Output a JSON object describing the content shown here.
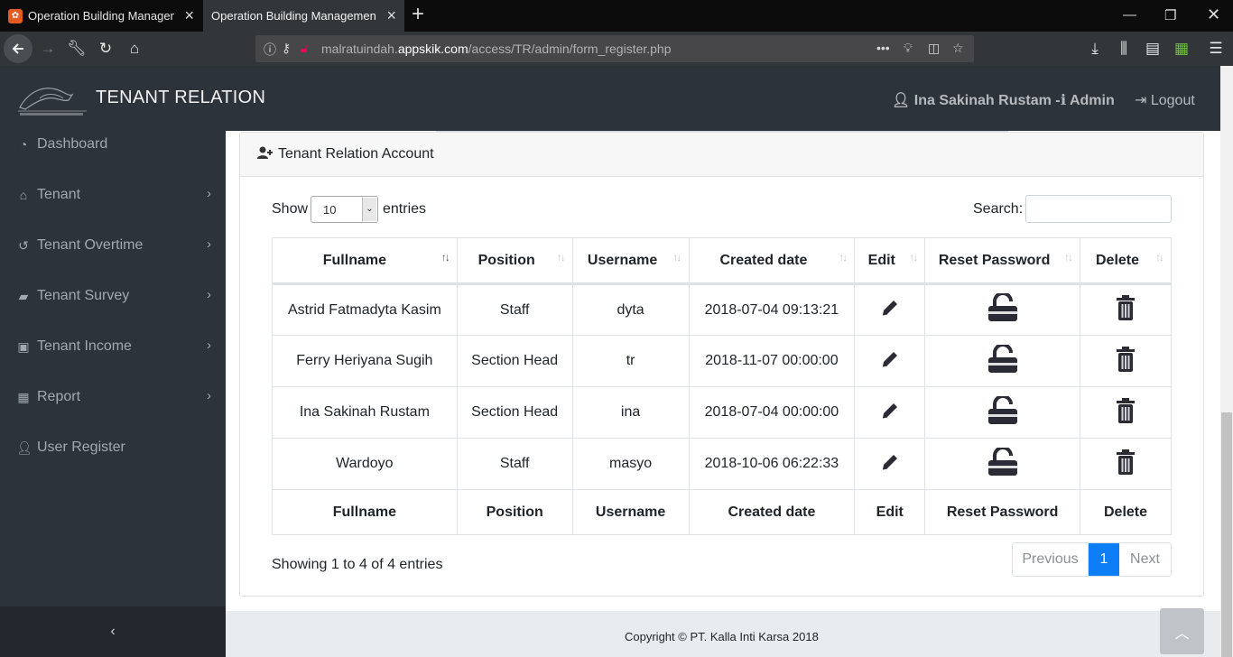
{
  "browser": {
    "tabs": [
      {
        "title": "Operation Building Management Sy",
        "active": false
      },
      {
        "title": "Operation Building Management Sy",
        "active": true
      }
    ],
    "url_prefix": "malratuindah.",
    "url_domain": "appskik.com",
    "url_path": "/access/TR/admin/form_register.php"
  },
  "header": {
    "brand": "TENANT RELATION",
    "user_name": "Ina Sakinah Rustam -",
    "role": "Admin",
    "logout": "Logout"
  },
  "sidebar": {
    "items": [
      {
        "label": "Dashboard",
        "icon": "dashboard-icon",
        "has_submenu": false
      },
      {
        "label": "Tenant",
        "icon": "home-icon",
        "has_submenu": true
      },
      {
        "label": "Tenant Overtime",
        "icon": "history-icon",
        "has_submenu": true
      },
      {
        "label": "Tenant Survey",
        "icon": "book-icon",
        "has_submenu": true
      },
      {
        "label": "Tenant Income",
        "icon": "money-icon",
        "has_submenu": true
      },
      {
        "label": "Report",
        "icon": "table-icon",
        "has_submenu": true
      },
      {
        "label": "User Register",
        "icon": "user-plus-icon",
        "has_submenu": false
      }
    ],
    "collapse_glyph": "‹"
  },
  "card": {
    "title": "Tenant Relation Account"
  },
  "table_controls": {
    "show_label": "Show",
    "entries_value": "10",
    "entries_label": "entries",
    "search_label": "Search:",
    "search_value": ""
  },
  "table": {
    "columns": [
      "Fullname",
      "Position",
      "Username",
      "Created date",
      "Edit",
      "Reset Password",
      "Delete"
    ],
    "rows": [
      {
        "fullname": "Astrid Fatmadyta Kasim",
        "position": "Staff",
        "username": "dyta",
        "created": "2018-07-04 09:13:21"
      },
      {
        "fullname": "Ferry Heriyana Sugih",
        "position": "Section Head",
        "username": "tr",
        "created": "2018-11-07 00:00:00"
      },
      {
        "fullname": "Ina Sakinah Rustam",
        "position": "Section Head",
        "username": "ina",
        "created": "2018-07-04 00:00:00"
      },
      {
        "fullname": "Wardoyo",
        "position": "Staff",
        "username": "masyo",
        "created": "2018-10-06 06:22:33"
      }
    ]
  },
  "info": "Showing 1 to 4 of 4 entries",
  "pagination": {
    "previous": "Previous",
    "current": "1",
    "next": "Next"
  },
  "footer": {
    "copyright": "Copyright © PT. Kalla Inti Karsa 2018"
  },
  "colors": {
    "sidebar_bg": "#2d333b",
    "accent": "#0d7ef5",
    "icon_dark": "#2b2b35"
  }
}
